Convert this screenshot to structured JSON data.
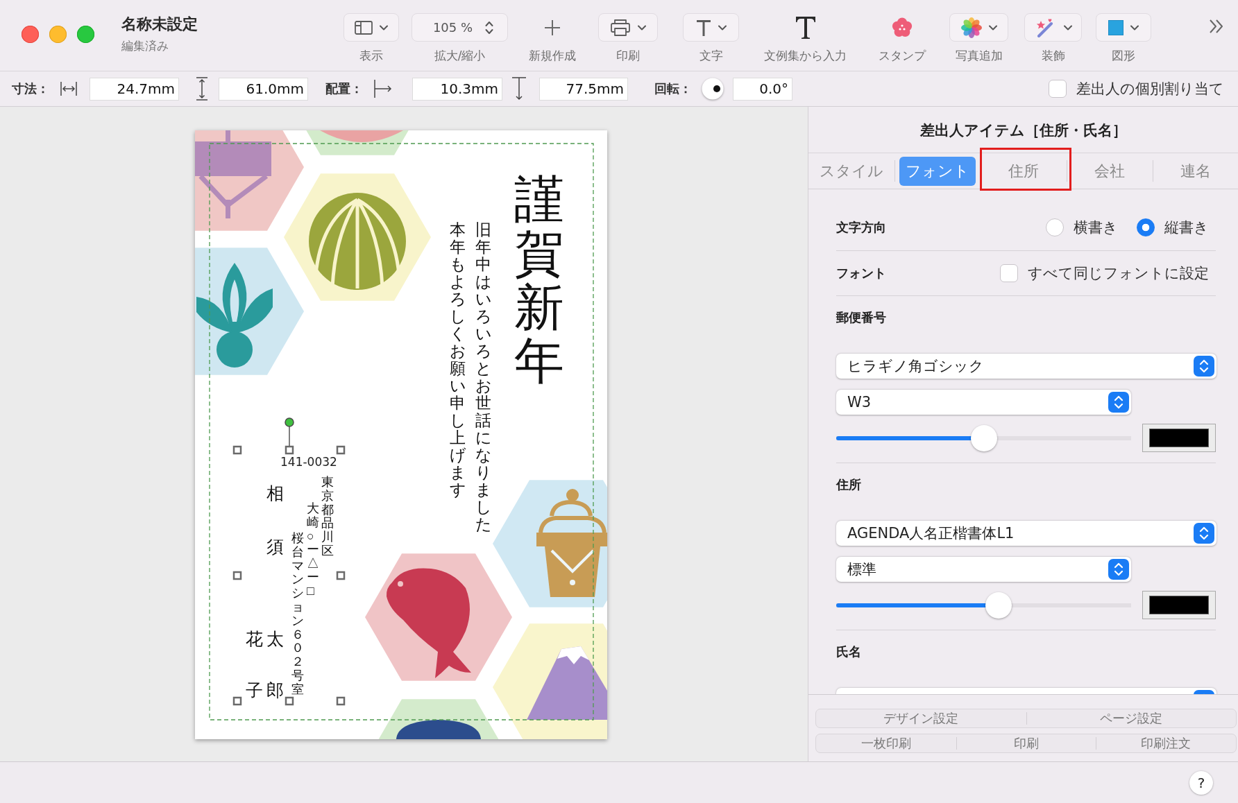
{
  "window": {
    "title": "名称未設定",
    "subtitle": "編集済み"
  },
  "toolbar": {
    "items": [
      {
        "kind": "menu",
        "label": "表示"
      },
      {
        "kind": "stepper",
        "label": "拡大/縮小",
        "value": "105 %"
      },
      {
        "kind": "plain",
        "label": "新規作成"
      },
      {
        "kind": "menu",
        "label": "印刷"
      },
      {
        "kind": "menu",
        "label": "文字"
      },
      {
        "kind": "plain",
        "label": "文例集から入力"
      },
      {
        "kind": "plain",
        "label": "スタンプ"
      },
      {
        "kind": "menu",
        "label": "写真追加"
      },
      {
        "kind": "menu",
        "label": "装飾"
      },
      {
        "kind": "menu",
        "label": "図形"
      }
    ]
  },
  "format_bar": {
    "size_label": "寸法：",
    "width": "24.7mm",
    "height": "61.0mm",
    "position_label": "配置：",
    "x": "10.3mm",
    "y": "77.5mm",
    "rotation_label": "回転：",
    "rotation": "0.0°",
    "individual_sender": {
      "label": "差出人の個別割り当て",
      "checked": false
    }
  },
  "card": {
    "greeting": "謹賀新年",
    "message": {
      "first_line": "旧年中はいろいろとお世話になりました",
      "second_line": "本年もよろしくお願い申し上げます"
    },
    "sender": {
      "selected": true,
      "postal_code": "141-0032",
      "address": [
        "東京都品川区",
        "大崎○ー△ー□",
        "桜台マンション６０２号室"
      ],
      "family_name": "相須",
      "given_name": "太郎",
      "joint_given_name": "花子"
    }
  },
  "inspector": {
    "title": "差出人アイテム［住所・氏名］",
    "tabs": [
      {
        "label": "スタイル",
        "selected": false,
        "highlighted": false
      },
      {
        "label": "フォント",
        "selected": true,
        "highlighted": false
      },
      {
        "label": "住所",
        "selected": false,
        "highlighted": true
      },
      {
        "label": "会社",
        "selected": false,
        "highlighted": false
      },
      {
        "label": "連名",
        "selected": false,
        "highlighted": false
      }
    ],
    "text_direction": {
      "label": "文字方向",
      "options": [
        {
          "label": "横書き",
          "selected": false
        },
        {
          "label": "縦書き",
          "selected": true
        }
      ]
    },
    "font": {
      "label": "フォント",
      "same_font": {
        "label": "すべて同じフォントに設定",
        "checked": false
      }
    },
    "sections": [
      {
        "title": "郵便番号",
        "font": "ヒラギノ角ゴシック",
        "weight": "W3",
        "size": {
          "level": 0.5
        },
        "color": "#000000"
      },
      {
        "title": "住所",
        "font": "AGENDA人名正楷書体L1",
        "weight": "標準",
        "size": {
          "level": 0.55
        },
        "color": "#000000"
      },
      {
        "title": "氏名"
      }
    ]
  },
  "footer": {
    "rows": [
      {
        "buttons": [
          "デザイン設定",
          "ページ設定"
        ]
      },
      {
        "buttons": [
          "一枚印刷",
          "印刷",
          "印刷注文"
        ]
      }
    ]
  },
  "status_bar": {
    "help": "?"
  }
}
